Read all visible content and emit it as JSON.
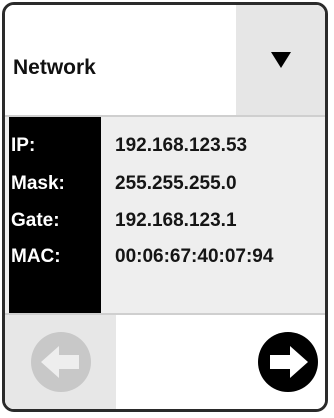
{
  "header": {
    "title": "Network",
    "dropdown_icon": "triangle-down-icon"
  },
  "network_info": {
    "rows": [
      {
        "label": "IP:",
        "value": "192.168.123.53"
      },
      {
        "label": "Mask:",
        "value": "255.255.255.0"
      },
      {
        "label": "Gate:",
        "value": "192.168.123.1"
      },
      {
        "label": "MAC:",
        "value": "00:06:67:40:07:94"
      }
    ]
  },
  "nav": {
    "back_icon": "back-arrow-icon",
    "next_icon": "forward-arrow-icon",
    "back_enabled": false,
    "next_enabled": true
  },
  "colors": {
    "label_panel": "#000000",
    "info_background": "#eeeeee",
    "disabled_icon": "#c8c8c8",
    "enabled_icon": "#000000"
  }
}
